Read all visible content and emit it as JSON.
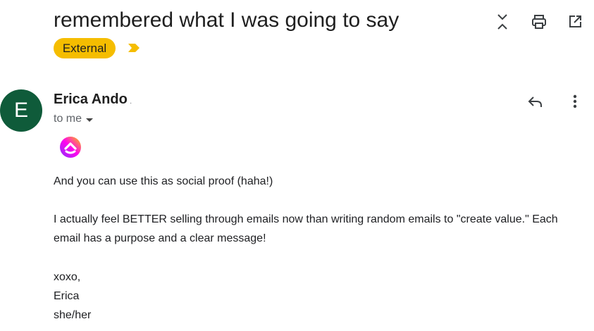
{
  "message": {
    "subject": "remembered what I was going to say",
    "label": "External"
  },
  "sender": {
    "avatar_initial": "E",
    "name": "Erica Ando",
    "name_suffix": "·",
    "recipient": "to me",
    "avatar_color": "#0f5b3a"
  },
  "body": {
    "paragraph1": "And you can use this as social proof (haha!)",
    "paragraph2": "I actually feel BETTER selling through emails now than writing random emails to \"create value.\" Each email has a purpose and a clear message!",
    "signoff": "xoxo,",
    "signature_name": "Erica",
    "pronouns": "she/her"
  },
  "icons": {
    "expand": "expand-collapse-icon",
    "print": "print-icon",
    "open_new_window": "open-in-new-window-icon",
    "reply": "reply-icon",
    "more": "more-vertical-icon",
    "logo": "clickup-logo-icon",
    "important": "important-marker-icon"
  },
  "colors": {
    "label_bg": "#f5bd00",
    "important_marker": "#f5bd00"
  }
}
